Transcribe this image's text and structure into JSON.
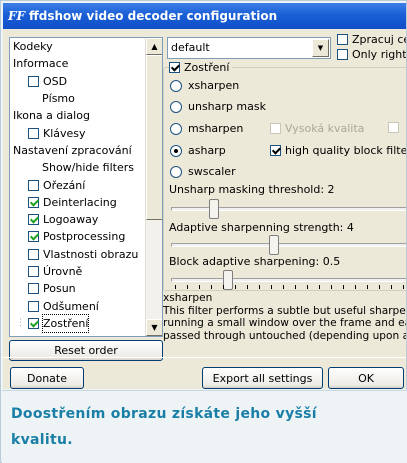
{
  "window": {
    "icon_text": "FF",
    "title": "ffdshow video decoder configuration"
  },
  "sidebar": {
    "items": [
      {
        "label": "Kodeky",
        "checkbox": null,
        "indent": 0
      },
      {
        "label": "Informace",
        "checkbox": null,
        "indent": 0
      },
      {
        "label": "OSD",
        "checkbox": false,
        "indent": 1
      },
      {
        "label": "Písmo",
        "checkbox": null,
        "indent": 2
      },
      {
        "label": "Ikona a dialog",
        "checkbox": null,
        "indent": 0
      },
      {
        "label": "Klávesy",
        "checkbox": false,
        "indent": 1
      },
      {
        "label": "Nastavení zpracování",
        "checkbox": null,
        "indent": 0
      },
      {
        "label": "Show/hide filters",
        "checkbox": null,
        "indent": 2
      },
      {
        "label": "Ořezání",
        "checkbox": false,
        "indent": 1
      },
      {
        "label": "Deinterlacing",
        "checkbox": true,
        "indent": 1
      },
      {
        "label": "Logoaway",
        "checkbox": true,
        "indent": 1
      },
      {
        "label": "Postprocessing",
        "checkbox": true,
        "indent": 1
      },
      {
        "label": "Vlastnosti obrazu",
        "checkbox": false,
        "indent": 1
      },
      {
        "label": "Úrovně",
        "checkbox": false,
        "indent": 1
      },
      {
        "label": "Posun",
        "checkbox": false,
        "indent": 1
      },
      {
        "label": "Odšumení",
        "checkbox": false,
        "indent": 1
      },
      {
        "label": "Zostření",
        "checkbox": true,
        "indent": 1,
        "selected": true
      }
    ],
    "reset_label": "Reset order"
  },
  "preset": {
    "value": "default",
    "option1": "Zpracuj ce",
    "option2": "Only right"
  },
  "sharpen": {
    "group_label": "Zostření",
    "enabled": true,
    "methods": [
      "xsharpen",
      "unsharp mask",
      "msharpen",
      "asharp",
      "swscaler"
    ],
    "selected_method": "asharp",
    "msharpen_hq_label": "Vysoká kvalita",
    "asharp_hq_label": "high quality block filter",
    "asharp_hq_checked": true,
    "unsharp_label": "Unsharp masking threshold: 2",
    "unsharp_value": 2,
    "adaptive_label": "Adaptive sharpenning strength: 4",
    "adaptive_value": 4,
    "block_label": "Block adaptive sharpening: 0.5",
    "block_value": 0.5
  },
  "description": {
    "title": "xsharpen",
    "line1": "This filter performs a subtle but useful sharpen",
    "line2": "running a small window over the frame and ea",
    "line3": "passed through untouched (depending upon a"
  },
  "footer": {
    "donate": "Donate",
    "export": "Export all settings",
    "ok": "OK"
  },
  "caption": {
    "line1": "Doostřením obrazu získáte jeho vyšší",
    "line2": "kvalitu."
  },
  "colors": {
    "titlebar": "#1a5fd6",
    "caption": "#1a7fa6"
  }
}
